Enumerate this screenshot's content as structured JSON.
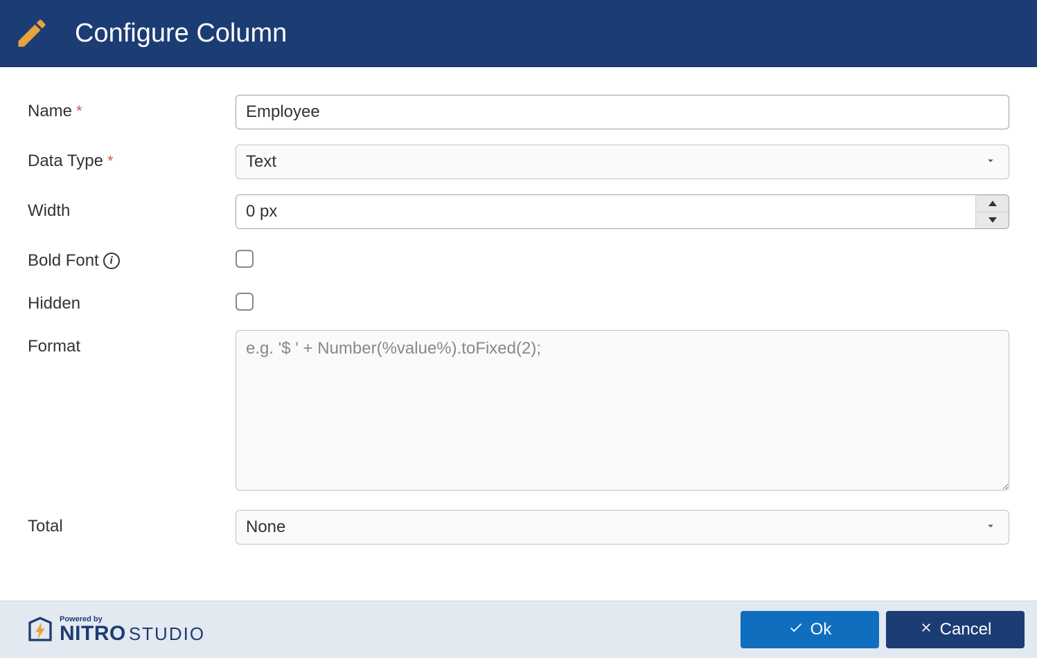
{
  "header": {
    "title": "Configure Column"
  },
  "form": {
    "name": {
      "label": "Name",
      "value": "Employee",
      "required": true
    },
    "dataType": {
      "label": "Data Type",
      "value": "Text",
      "required": true
    },
    "width": {
      "label": "Width",
      "value": "0 px"
    },
    "boldFont": {
      "label": "Bold Font",
      "checked": false
    },
    "hidden": {
      "label": "Hidden",
      "checked": false
    },
    "format": {
      "label": "Format",
      "placeholder": "e.g. '$ ' + Number(%value%).toFixed(2);",
      "value": ""
    },
    "total": {
      "label": "Total",
      "value": "None"
    }
  },
  "footer": {
    "ok": "Ok",
    "cancel": "Cancel",
    "poweredBy": "Powered by",
    "brand": "NITRO",
    "brandSuffix": "STUDIO"
  }
}
